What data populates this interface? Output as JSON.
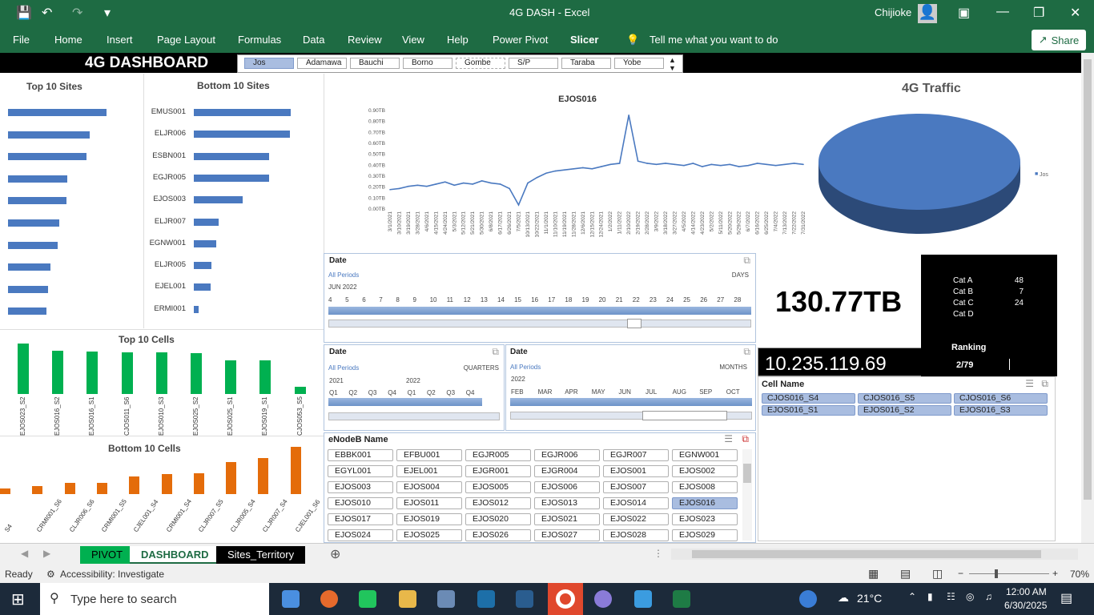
{
  "window": {
    "title": "4G DASH  -  Excel",
    "user": "Chijioke"
  },
  "ribbon": {
    "tabs": [
      "File",
      "Home",
      "Insert",
      "Page Layout",
      "Formulas",
      "Data",
      "Review",
      "View",
      "Help",
      "Power Pivot",
      "Slicer"
    ],
    "tell_me": "Tell me what you want to do",
    "share": "Share"
  },
  "dashboard": {
    "title": "4G DASHBOARD"
  },
  "regions": {
    "items": [
      "Jos",
      "Adamawa",
      "Bauchi",
      "Borno",
      "Gombe",
      "S/P",
      "Taraba",
      "Yobe"
    ],
    "selected": "Jos"
  },
  "top_sites": {
    "title": "Top 10 Sites",
    "values": [
      1.0,
      0.83,
      0.8,
      0.6,
      0.59,
      0.52,
      0.5,
      0.43,
      0.41,
      0.39
    ]
  },
  "bottom_sites": {
    "title": "Bottom 10 Sites",
    "labels": [
      "EMUS001",
      "ELJR006",
      "ESBN001",
      "EGJR005",
      "EJOS003",
      "ELJR007",
      "EGNW001",
      "ELJR005",
      "EJEL001",
      "ERMI001"
    ],
    "values": [
      1.0,
      0.99,
      0.78,
      0.78,
      0.5,
      0.26,
      0.23,
      0.18,
      0.17,
      0.05
    ]
  },
  "top_cells": {
    "title": "Top 10 Cells",
    "labels": [
      "EJOS023_S2",
      "EJOS016_S2",
      "EJOS016_S1",
      "CJOS011_S6",
      "EJOS010_S3",
      "EJOS025_S2",
      "EJOS025_S1",
      "EJOS019_S1",
      "CJOS053_S5"
    ],
    "values": [
      1.0,
      0.85,
      0.84,
      0.82,
      0.82,
      0.81,
      0.67,
      0.67,
      0.15
    ]
  },
  "bottom_cells": {
    "title": "Bottom  10 Cells",
    "labels": [
      "S4",
      "CRMI001_S6",
      "CLJR006_S6",
      "CRMI001_S5",
      "CJEL001_S4",
      "CRMI001_S4",
      "CLJR007_S5",
      "CLJR005_S4",
      "CLJR007_S4",
      "CJEL001_S6"
    ],
    "values": [
      0.12,
      0.17,
      0.24,
      0.24,
      0.37,
      0.43,
      0.44,
      0.68,
      0.77,
      1.0
    ]
  },
  "chart_data": {
    "type": "line",
    "title": "EJOS016",
    "ylim": [
      0,
      0.9
    ],
    "yticks": [
      "0.00TB",
      "0.10TB",
      "0.20TB",
      "0.30TB",
      "0.40TB",
      "0.50TB",
      "0.60TB",
      "0.70TB",
      "0.80TB",
      "0.90TB"
    ],
    "xticks": [
      "3/1/2021",
      "3/10/2021",
      "3/19/2021",
      "3/28/2021",
      "4/6/2021",
      "4/15/2021",
      "4/24/2021",
      "5/3/2021",
      "5/12/2021",
      "5/21/2021",
      "5/30/2021",
      "6/8/2021",
      "6/17/2021",
      "6/26/2021",
      "7/5/2021",
      "10/13/2021",
      "10/22/2021",
      "11/1/2021",
      "11/10/2021",
      "11/19/2021",
      "11/28/2021",
      "12/6/2021",
      "12/15/2021",
      "12/24/2021",
      "1/2/2022",
      "1/11/2022",
      "2/10/2022",
      "2/19/2022",
      "2/28/2022",
      "3/9/2022",
      "3/18/2022",
      "3/27/2022",
      "4/5/2022",
      "4/14/2022",
      "4/23/2022",
      "5/2/2022",
      "5/11/2022",
      "5/20/2022",
      "5/29/2022",
      "6/7/2022",
      "6/16/2022",
      "6/25/2022",
      "7/4/2022",
      "7/13/2022",
      "7/22/2022",
      "7/31/2022"
    ],
    "values": [
      0.17,
      0.18,
      0.2,
      0.21,
      0.2,
      0.22,
      0.24,
      0.21,
      0.23,
      0.22,
      0.25,
      0.23,
      0.22,
      0.18,
      0.03,
      0.23,
      0.28,
      0.32,
      0.34,
      0.35,
      0.36,
      0.37,
      0.36,
      0.38,
      0.4,
      0.41,
      0.85,
      0.43,
      0.41,
      0.4,
      0.41,
      0.4,
      0.39,
      0.41,
      0.38,
      0.4,
      0.39,
      0.4,
      0.38,
      0.39,
      0.41,
      0.4,
      0.39,
      0.4,
      0.41,
      0.4
    ]
  },
  "pie": {
    "title": "4G Traffic",
    "legend": "Jos",
    "color": "#4a79c0"
  },
  "date_timeline": {
    "header": "Date",
    "all_periods": "All Periods",
    "level": "DAYS",
    "month": "JUN 2022",
    "days": [
      "4",
      "5",
      "6",
      "7",
      "8",
      "9",
      "10",
      "11",
      "12",
      "13",
      "14",
      "15",
      "16",
      "17",
      "18",
      "19",
      "20",
      "21",
      "22",
      "23",
      "24",
      "25",
      "26",
      "27",
      "28"
    ]
  },
  "quarter_timeline": {
    "header": "Date",
    "all_periods": "All Periods",
    "level": "QUARTERS",
    "years": [
      "2021",
      "2022"
    ],
    "quarters": [
      "Q1",
      "Q2",
      "Q3",
      "Q4",
      "Q1",
      "Q2",
      "Q3",
      "Q4"
    ]
  },
  "month_timeline": {
    "header": "Date",
    "all_periods": "All Periods",
    "level": "MONTHS",
    "year": "2022",
    "months": [
      "FEB",
      "MAR",
      "APR",
      "MAY",
      "JUN",
      "JUL",
      "AUG",
      "SEP",
      "OCT"
    ]
  },
  "kpi": {
    "total": "130.77TB",
    "secondary": "10.235.119.69"
  },
  "categories": {
    "rows": [
      {
        "name": "Cat A",
        "value": "48"
      },
      {
        "name": "Cat B",
        "value": "7"
      },
      {
        "name": "Cat C",
        "value": "24"
      },
      {
        "name": "Cat D",
        "value": ""
      }
    ],
    "ranking_label": "Ranking",
    "ranking_value": "2/79"
  },
  "cell_name": {
    "header": "Cell Name",
    "items": [
      "CJOS016_S4",
      "CJOS016_S5",
      "CJOS016_S6",
      "EJOS016_S1",
      "EJOS016_S2",
      "EJOS016_S3"
    ]
  },
  "enodeb": {
    "header": "eNodeB Name",
    "items": [
      "EBBK001",
      "EFBU001",
      "EGJR005",
      "EGJR006",
      "EGJR007",
      "EGNW001",
      "EGYL001",
      "EJEL001",
      "EJGR001",
      "EJGR004",
      "EJOS001",
      "EJOS002",
      "EJOS003",
      "EJOS004",
      "EJOS005",
      "EJOS006",
      "EJOS007",
      "EJOS008",
      "EJOS010",
      "EJOS011",
      "EJOS012",
      "EJOS013",
      "EJOS014",
      "EJOS016",
      "EJOS017",
      "EJOS019",
      "EJOS020",
      "EJOS021",
      "EJOS022",
      "EJOS023",
      "EJOS024",
      "EJOS025",
      "EJOS026",
      "EJOS027",
      "EJOS028",
      "EJOS029"
    ],
    "selected": "EJOS016"
  },
  "sheets": {
    "tabs": [
      "PIVOT",
      "DASHBOARD",
      "Sites_Territory"
    ],
    "active": "DASHBOARD"
  },
  "status": {
    "ready": "Ready",
    "accessibility": "Accessibility: Investigate",
    "zoom": "70%"
  },
  "taskbar": {
    "search": "Type here to search",
    "temp": "21°C",
    "time": "12:00 AM",
    "date": "6/30/2025"
  }
}
